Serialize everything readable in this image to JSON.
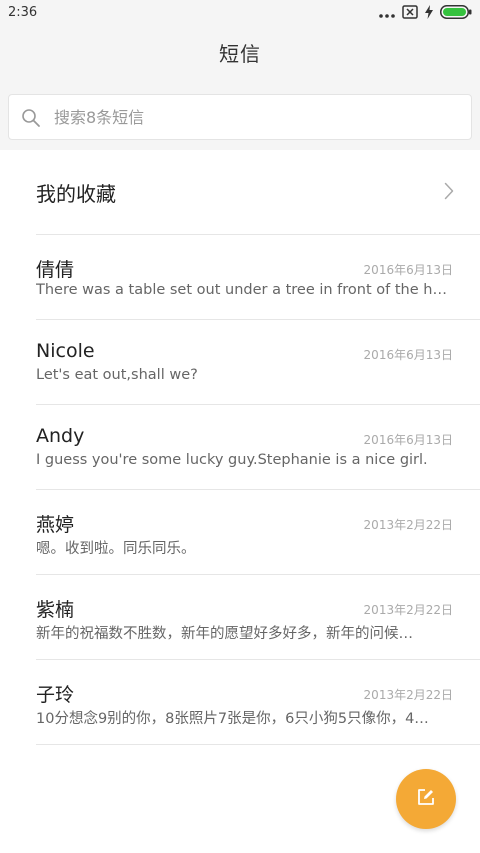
{
  "status_bar": {
    "time": "2:36",
    "icons": [
      "signal-dots-icon",
      "no-sim-icon",
      "charging-icon",
      "battery-icon"
    ],
    "battery_color": "#35c23e"
  },
  "header": {
    "title": "短信"
  },
  "search": {
    "placeholder": "搜索8条短信",
    "value": ""
  },
  "favorites": {
    "label": "我的收藏"
  },
  "conversations": [
    {
      "name": "倩倩",
      "date": "2016年6月13日",
      "preview": "There was a table set out under a tree in front of the hous"
    },
    {
      "name": "Nicole",
      "date": "2016年6月13日",
      "preview": "Let's eat out,shall we?"
    },
    {
      "name": "Andy",
      "date": "2016年6月13日",
      "preview": "I guess you're some lucky guy.Stephanie is a nice girl."
    },
    {
      "name": "燕婷",
      "date": "2013年2月22日",
      "preview": "嗯。收到啦。同乐同乐。"
    },
    {
      "name": "紫楠",
      "date": "2013年2月22日",
      "preview": "新年的祝福数不胜数，新年的愿望好多好多，新年的问候…"
    },
    {
      "name": "子玲",
      "date": "2013年2月22日",
      "preview": "10分想念9别的你，8张照片7张是你，6只小狗5只像你，4…"
    }
  ],
  "compose_button": {
    "icon": "compose-icon",
    "color": "#f4a936"
  }
}
